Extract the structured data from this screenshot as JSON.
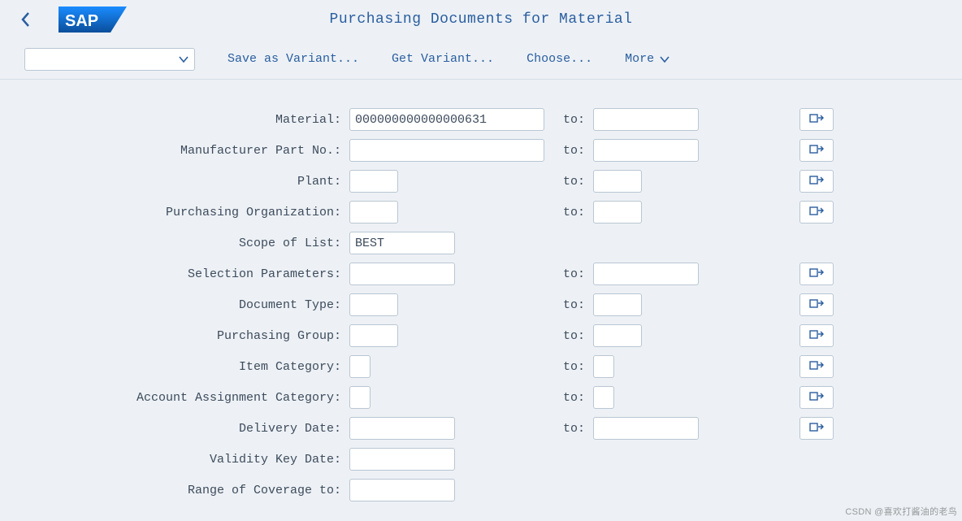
{
  "header": {
    "title": "Purchasing Documents for Material",
    "logo_text": "SAP"
  },
  "toolbar": {
    "save_variant": "Save as Variant...",
    "get_variant": "Get Variant...",
    "choose": "Choose...",
    "more": "More"
  },
  "labels": {
    "to": "to:"
  },
  "fields": {
    "material": {
      "label": "Material:",
      "from": "000000000000000631",
      "to": "",
      "fw": "w240",
      "tw": "w130",
      "range": true
    },
    "mfr_part": {
      "label": "Manufacturer Part No.:",
      "from": "",
      "to": "",
      "fw": "w240",
      "tw": "w130",
      "range": true
    },
    "plant": {
      "label": "Plant:",
      "from": "",
      "to": "",
      "fw": "w60",
      "tw": "w60",
      "range": true
    },
    "purch_org": {
      "label": "Purchasing Organization:",
      "from": "",
      "to": "",
      "fw": "w60",
      "tw": "w60",
      "range": true
    },
    "scope_list": {
      "label": "Scope of List:",
      "from": "BEST",
      "fw": "w130",
      "range": false,
      "selected": true
    },
    "sel_params": {
      "label": "Selection Parameters:",
      "from": "",
      "to": "",
      "fw": "w130",
      "tw": "w130",
      "range": true
    },
    "doc_type": {
      "label": "Document Type:",
      "from": "",
      "to": "",
      "fw": "w60",
      "tw": "w60",
      "range": true
    },
    "purch_group": {
      "label": "Purchasing Group:",
      "from": "",
      "to": "",
      "fw": "w60",
      "tw": "w60",
      "range": true
    },
    "item_cat": {
      "label": "Item Category:",
      "from": "",
      "to": "",
      "fw": "w26",
      "tw": "w26",
      "range": true
    },
    "acct_assign": {
      "label": "Account Assignment Category:",
      "from": "",
      "to": "",
      "fw": "w26",
      "tw": "w26",
      "range": true
    },
    "deliv_date": {
      "label": "Delivery Date:",
      "from": "",
      "to": "",
      "fw": "w130",
      "tw": "w130",
      "range": true
    },
    "validity_date": {
      "label": "Validity Key Date:",
      "from": "",
      "fw": "w130",
      "range": false
    },
    "range_cov": {
      "label": "Range of Coverage to:",
      "from": "",
      "fw": "w130",
      "range": false
    }
  },
  "watermark": "CSDN @喜欢打酱油的老鸟"
}
